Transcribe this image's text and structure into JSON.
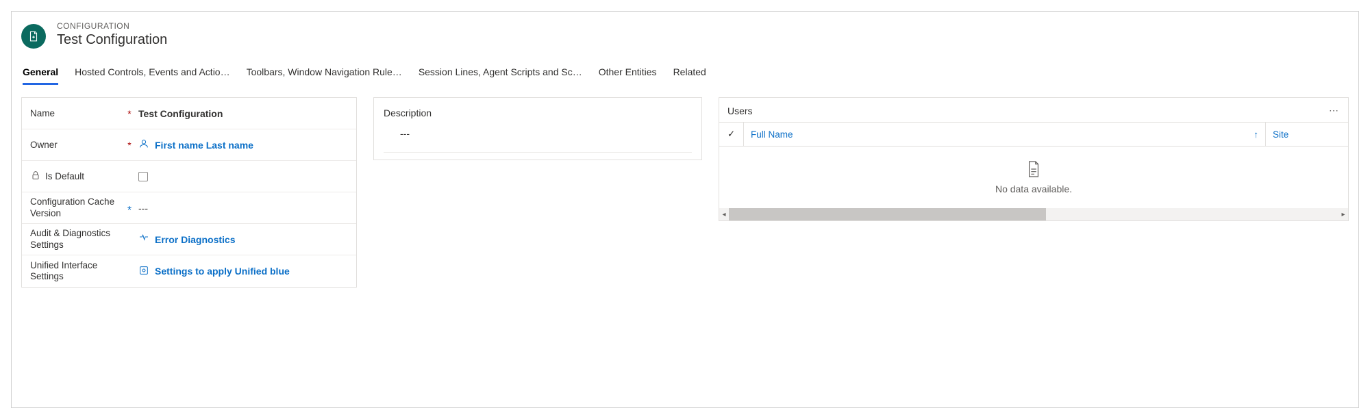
{
  "header": {
    "entity_label": "CONFIGURATION",
    "title": "Test Configuration"
  },
  "tabs": [
    {
      "label": "General",
      "active": true
    },
    {
      "label": "Hosted Controls, Events and Actio…",
      "active": false
    },
    {
      "label": "Toolbars, Window Navigation Rule…",
      "active": false
    },
    {
      "label": "Session Lines, Agent Scripts and Sc…",
      "active": false
    },
    {
      "label": "Other Entities",
      "active": false
    },
    {
      "label": "Related",
      "active": false
    }
  ],
  "form": {
    "name_label": "Name",
    "name_value": "Test Configuration",
    "owner_label": "Owner",
    "owner_value": "First name Last name",
    "is_default_label": "Is Default",
    "cache_label": "Configuration Cache Version",
    "cache_value": "---",
    "audit_label": "Audit & Diagnostics Settings",
    "audit_value": "Error Diagnostics",
    "unified_label": "Unified Interface Settings",
    "unified_value": "Settings to apply Unified blue"
  },
  "description": {
    "label": "Description",
    "value": "---"
  },
  "users": {
    "title": "Users",
    "columns": {
      "fullname": "Full Name",
      "site": "Site"
    },
    "empty": "No data available."
  },
  "symbols": {
    "required": "*",
    "recommended": "*",
    "check": "✓",
    "asc": "↑",
    "more": "⋯",
    "left": "◂",
    "right": "▸"
  }
}
